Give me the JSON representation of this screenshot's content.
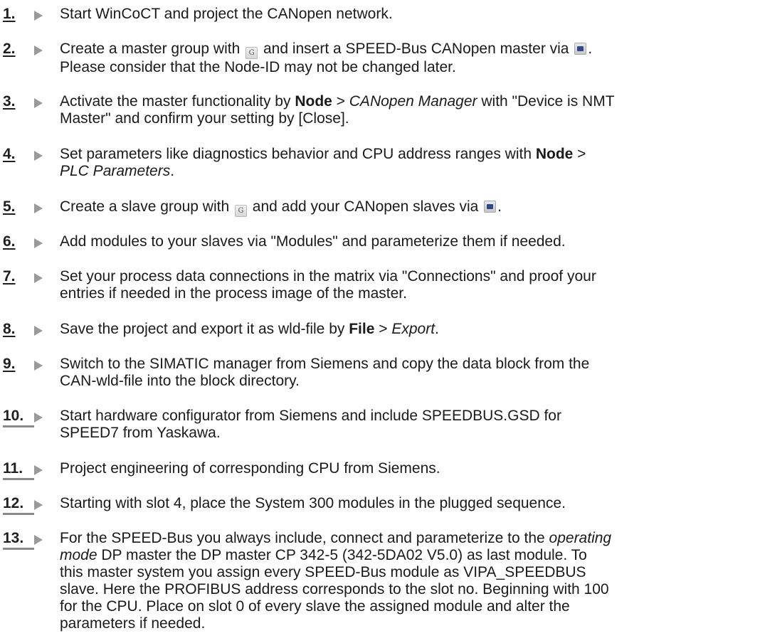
{
  "steps": [
    {
      "num": "1.",
      "lines": [
        [
          "Start WinCoCT and project the CANopen network."
        ]
      ]
    },
    {
      "num": "2.",
      "line1": [
        "Create a master group with ",
        "icon:group",
        " and insert a SPEED-Bus CANopen master via ",
        "icon:node",
        "."
      ],
      "line2": "Please consider that the Node-ID may not be changed later."
    },
    {
      "num": "3.",
      "a": "Activate the master functionality by ",
      "b": "Node",
      "c": " > ",
      "d": "CANopen Manager",
      "e": " with \"Device is NMT",
      "line2": "Master\" and confirm your setting by [Close]."
    },
    {
      "num": "4.",
      "a": "Set parameters like diagnostics behavior and CPU address ranges with ",
      "b": "Node",
      "c": " >",
      "line2": "PLC Parameters",
      "line2b": "."
    },
    {
      "num": "5.",
      "a": "Create a slave group with ",
      "b": " and add your CANopen slaves via ",
      "c": "."
    },
    {
      "num": "6.",
      "a": "Add modules to your slaves via \"Modules\" and parameterize them if needed."
    },
    {
      "num": "7.",
      "a": "Set your process data connections in the matrix via \"Connections\" and proof your",
      "line2": "entries if needed in the process image of the master."
    },
    {
      "num": "8.",
      "a": "Save the project and export it as wld-file by ",
      "b": "File",
      "c": " > ",
      "d": "Export",
      "e": "."
    },
    {
      "num": "9.",
      "a": "Switch to the SIMATIC manager from Siemens and copy the data block from the",
      "line2": "CAN-wld-file into the block directory."
    },
    {
      "num": "10.",
      "a": "Start hardware configurator from Siemens and include SPEEDBUS.GSD for",
      "line2": "SPEED7 from Yaskawa."
    },
    {
      "num": "11.",
      "a": "Project engineering of corresponding CPU from Siemens."
    },
    {
      "num": "12.",
      "a": "Starting with slot 4, place the System 300 modules in the plugged sequence."
    },
    {
      "num": "13.",
      "a": "For the SPEED-Bus you always include, connect and parameterize to the ",
      "b": "operating",
      "line2a": "mode",
      "line2b": " DP master the DP master CP 342-5 (342-5DA02 V5.0) as last module. To",
      "line3": "this master system you assign every SPEED-Bus module as VIPA_SPEEDBUS",
      "line4": "slave. Here the PROFIBUS address corresponds to the slot no. Beginning with 100",
      "line5": "for the CPU. Place on slot 0 of every slave the assigned module and alter the",
      "line6": "parameters if needed."
    }
  ],
  "icons": {
    "group_icon": "group-icon",
    "node_icon": "canopen-node-icon",
    "group_glyph": "G"
  }
}
